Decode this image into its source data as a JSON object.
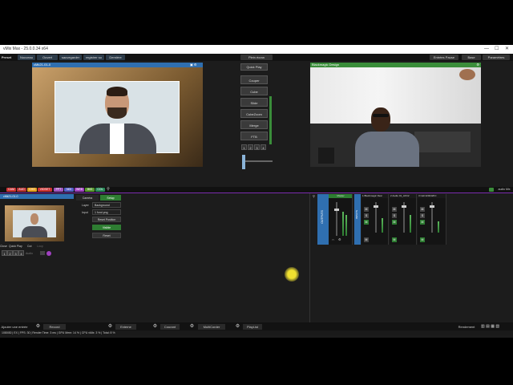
{
  "window": {
    "title": "vMix Max - 25.0.0.34 x64"
  },
  "menu": {
    "preset": "Preset",
    "items": [
      "Nouveau",
      "Ouvert",
      "sauvegarder",
      "registrer so",
      "Dernière"
    ],
    "center_label": "Plein écran",
    "right_items": [
      "Entrées Pause",
      "Base",
      "Paramètres"
    ]
  },
  "preview": {
    "title": "cMk21-01-0"
  },
  "output": {
    "title": "Blackmagic Design"
  },
  "transitions": {
    "quick_play": "Quick Play",
    "buttons": [
      "Couper",
      "Cube",
      "Slide",
      "CubeZoom",
      "Merge",
      "FTB"
    ],
    "numbers": [
      "1",
      "2",
      "3",
      "4"
    ]
  },
  "filters": [
    "CAM",
    "AUD",
    "CHG",
    "VIDSET",
    "PPT",
    "NDI",
    "WEB",
    "IMG",
    "COL"
  ],
  "input": {
    "title": "cMk21-01-0",
    "tabs": [
      "Caméra",
      "Setup"
    ],
    "layer_label": "Layer",
    "layer_value": "Background",
    "input_label": "Input",
    "input_value": "1 fond.png",
    "reset": "Reset Position",
    "visible": "Visible",
    "reset2": "Reset",
    "bottom_labels": [
      "Close",
      "Quick Play",
      "Cut",
      "Loop"
    ],
    "numbers": [
      "1",
      "2",
      "3",
      "4"
    ],
    "audio": "Audio"
  },
  "audio_mixer": {
    "outputs": "OUTPUTS",
    "master": "Master",
    "inputs": "INPUTS",
    "channels": [
      {
        "num": "1",
        "name": "Blackmagic Desi"
      },
      {
        "num": "2",
        "name": "Audio 01_AFC2"
      },
      {
        "num": "3",
        "name": "Call 420242FC"
      }
    ],
    "audio_mixer_label": "audio Mix"
  },
  "bottom": {
    "add_input": "Ajouter une entrée",
    "buttons": [
      "Record",
      "Externe",
      "Courant",
      "MultiCorder",
      "PlayList"
    ],
    "right": "Rendement"
  },
  "status": {
    "text": "1080i30 | EX | FPS: 30 | Render Time: 3 ms | GPU Mem: 14 % | CPU vMix: 3 % | Total: 8 %"
  }
}
